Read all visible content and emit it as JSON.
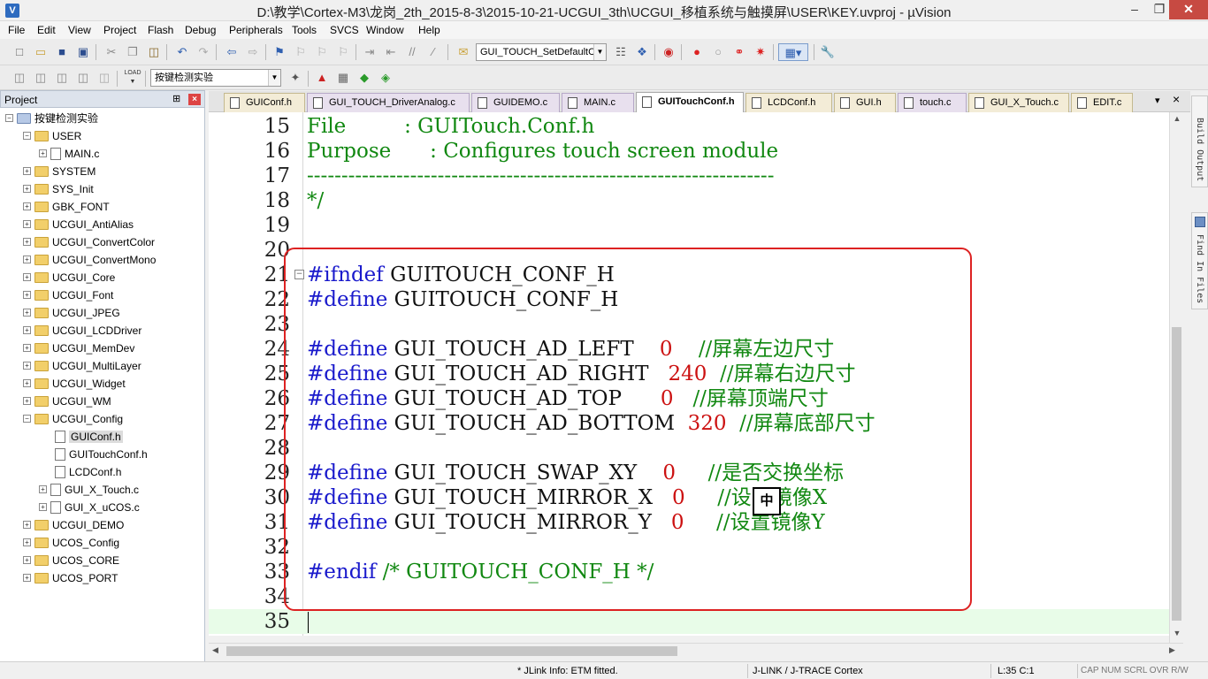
{
  "window": {
    "title": "D:\\教学\\Cortex-M3\\龙岗_2th_2015-8-3\\2015-10-21-UCGUI_3th\\UCGUI_移植系统与触摸屏\\USER\\KEY.uvproj - µVision",
    "app_icon": "V"
  },
  "menu": [
    "File",
    "Edit",
    "View",
    "Project",
    "Flash",
    "Debug",
    "Peripherals",
    "Tools",
    "SVCS",
    "Window",
    "Help"
  ],
  "toolbar": {
    "function_combo": "GUI_TOUCH_SetDefaultC",
    "target_combo": "按键检测实验"
  },
  "project_panel": {
    "title": "Project",
    "pin": "⊞",
    "close": "×",
    "tree": [
      {
        "label": "按键检测实验",
        "type": "root",
        "expand": "−"
      },
      {
        "label": "USER",
        "type": "folder",
        "expand": "−"
      },
      {
        "label": "MAIN.c",
        "type": "file",
        "expand": "+"
      },
      {
        "label": "SYSTEM",
        "type": "folder",
        "expand": "+"
      },
      {
        "label": "SYS_Init",
        "type": "folder",
        "expand": "+"
      },
      {
        "label": "GBK_FONT",
        "type": "folder",
        "expand": "+"
      },
      {
        "label": "UCGUI_AntiAlias",
        "type": "folder",
        "expand": "+"
      },
      {
        "label": "UCGUI_ConvertColor",
        "type": "folder",
        "expand": "+"
      },
      {
        "label": "UCGUI_ConvertMono",
        "type": "folder",
        "expand": "+"
      },
      {
        "label": "UCGUI_Core",
        "type": "folder",
        "expand": "+"
      },
      {
        "label": "UCGUI_Font",
        "type": "folder",
        "expand": "+"
      },
      {
        "label": "UCGUI_JPEG",
        "type": "folder",
        "expand": "+"
      },
      {
        "label": "UCGUI_LCDDriver",
        "type": "folder",
        "expand": "+"
      },
      {
        "label": "UCGUI_MemDev",
        "type": "folder",
        "expand": "+"
      },
      {
        "label": "UCGUI_MultiLayer",
        "type": "folder",
        "expand": "+"
      },
      {
        "label": "UCGUI_Widget",
        "type": "folder",
        "expand": "+"
      },
      {
        "label": "UCGUI_WM",
        "type": "folder",
        "expand": "+"
      },
      {
        "label": "UCGUI_Config",
        "type": "folder",
        "expand": "−"
      },
      {
        "label": "GUIConf.h",
        "type": "file",
        "expand": ""
      },
      {
        "label": "GUITouchConf.h",
        "type": "file",
        "expand": ""
      },
      {
        "label": "LCDConf.h",
        "type": "file",
        "expand": ""
      },
      {
        "label": "GUI_X_Touch.c",
        "type": "file",
        "expand": "+"
      },
      {
        "label": "GUI_X_uCOS.c",
        "type": "file",
        "expand": "+"
      },
      {
        "label": "UCGUI_DEMO",
        "type": "folder",
        "expand": "+"
      },
      {
        "label": "UCOS_Config",
        "type": "folder",
        "expand": "+"
      },
      {
        "label": "UCOS_CORE",
        "type": "folder",
        "expand": "+"
      },
      {
        "label": "UCOS_PORT",
        "type": "folder",
        "expand": "+"
      }
    ]
  },
  "tabs": [
    {
      "label": "GUIConf.h",
      "style": "yellow"
    },
    {
      "label": "GUI_TOUCH_DriverAnalog.c",
      "style": "pink"
    },
    {
      "label": "GUIDEMO.c",
      "style": "pink"
    },
    {
      "label": "MAIN.c",
      "style": "pink"
    },
    {
      "label": "GUITouchConf.h",
      "style": "active"
    },
    {
      "label": "LCDConf.h",
      "style": "yellow"
    },
    {
      "label": "GUI.h",
      "style": "yellow"
    },
    {
      "label": "touch.c",
      "style": "pink"
    },
    {
      "label": "GUI_X_Touch.c",
      "style": "yellow"
    },
    {
      "label": "EDIT.c",
      "style": "yellow"
    }
  ],
  "tab_controls": {
    "dropdown": "▾",
    "close": "×"
  },
  "editor": {
    "lines": [
      {
        "n": "15",
        "parts": [
          {
            "c": "cmt",
            "t": "File         : GUITouch.Conf.h"
          }
        ]
      },
      {
        "n": "16",
        "parts": [
          {
            "c": "cmt",
            "t": "Purpose      : Configures touch screen module"
          }
        ]
      },
      {
        "n": "17",
        "parts": [
          {
            "c": "cmt",
            "t": "--------------------------------------------------------------------"
          }
        ]
      },
      {
        "n": "18",
        "parts": [
          {
            "c": "cmt",
            "t": "*/"
          }
        ]
      },
      {
        "n": "19",
        "parts": []
      },
      {
        "n": "20",
        "parts": []
      },
      {
        "n": "21",
        "parts": [
          {
            "c": "kw",
            "t": "#ifndef"
          },
          {
            "c": "plain",
            "t": " GUITOUCH_CONF_H"
          }
        ]
      },
      {
        "n": "22",
        "parts": [
          {
            "c": "kw",
            "t": "#define"
          },
          {
            "c": "plain",
            "t": " GUITOUCH_CONF_H"
          }
        ]
      },
      {
        "n": "23",
        "parts": []
      },
      {
        "n": "24",
        "parts": [
          {
            "c": "kw",
            "t": "#define"
          },
          {
            "c": "plain",
            "t": " GUI_TOUCH_AD_LEFT    "
          },
          {
            "c": "num-lit",
            "t": "0"
          },
          {
            "c": "plain",
            "t": "    "
          },
          {
            "c": "cmt",
            "t": "//屏幕左边尺寸"
          }
        ]
      },
      {
        "n": "25",
        "parts": [
          {
            "c": "kw",
            "t": "#define"
          },
          {
            "c": "plain",
            "t": " GUI_TOUCH_AD_RIGHT   "
          },
          {
            "c": "num-lit",
            "t": "240"
          },
          {
            "c": "plain",
            "t": "  "
          },
          {
            "c": "cmt",
            "t": "//屏幕右边尺寸"
          }
        ]
      },
      {
        "n": "26",
        "parts": [
          {
            "c": "kw",
            "t": "#define"
          },
          {
            "c": "plain",
            "t": " GUI_TOUCH_AD_TOP      "
          },
          {
            "c": "num-lit",
            "t": "0"
          },
          {
            "c": "plain",
            "t": "   "
          },
          {
            "c": "cmt",
            "t": "//屏幕顶端尺寸"
          }
        ]
      },
      {
        "n": "27",
        "parts": [
          {
            "c": "kw",
            "t": "#define"
          },
          {
            "c": "plain",
            "t": " GUI_TOUCH_AD_BOTTOM  "
          },
          {
            "c": "num-lit",
            "t": "320"
          },
          {
            "c": "plain",
            "t": "  "
          },
          {
            "c": "cmt",
            "t": "//屏幕底部尺寸"
          }
        ]
      },
      {
        "n": "28",
        "parts": []
      },
      {
        "n": "29",
        "parts": [
          {
            "c": "kw",
            "t": "#define"
          },
          {
            "c": "plain",
            "t": " GUI_TOUCH_SWAP_XY    "
          },
          {
            "c": "num-lit",
            "t": "0"
          },
          {
            "c": "plain",
            "t": "     "
          },
          {
            "c": "cmt",
            "t": "//是否交换坐标"
          }
        ]
      },
      {
        "n": "30",
        "parts": [
          {
            "c": "kw",
            "t": "#define"
          },
          {
            "c": "plain",
            "t": " GUI_TOUCH_MIRROR_X   "
          },
          {
            "c": "num-lit",
            "t": "0"
          },
          {
            "c": "plain",
            "t": "     "
          },
          {
            "c": "cmt",
            "t": "//设置镜像X"
          }
        ]
      },
      {
        "n": "31",
        "parts": [
          {
            "c": "kw",
            "t": "#define"
          },
          {
            "c": "plain",
            "t": " GUI_TOUCH_MIRROR_Y   "
          },
          {
            "c": "num-lit",
            "t": "0"
          },
          {
            "c": "plain",
            "t": "     "
          },
          {
            "c": "cmt",
            "t": "//设置镜像Y"
          }
        ]
      },
      {
        "n": "32",
        "parts": []
      },
      {
        "n": "33",
        "parts": [
          {
            "c": "kw",
            "t": "#endif"
          },
          {
            "c": "plain",
            "t": " "
          },
          {
            "c": "cmt",
            "t": "/* GUITOUCH_CONF_H */"
          }
        ]
      },
      {
        "n": "34",
        "parts": []
      },
      {
        "n": "35",
        "parts": []
      }
    ],
    "ime_char": "中"
  },
  "side_tabs": [
    {
      "label": "Build Output"
    },
    {
      "label": "Find In Files"
    }
  ],
  "statusbar": {
    "info": "* JLink Info: ETM fitted.",
    "debugger": "J-LINK / J-TRACE Cortex",
    "position": "L:35 C:1",
    "indicators": "CAP  NUM  SCRL  OVR  R/W"
  }
}
